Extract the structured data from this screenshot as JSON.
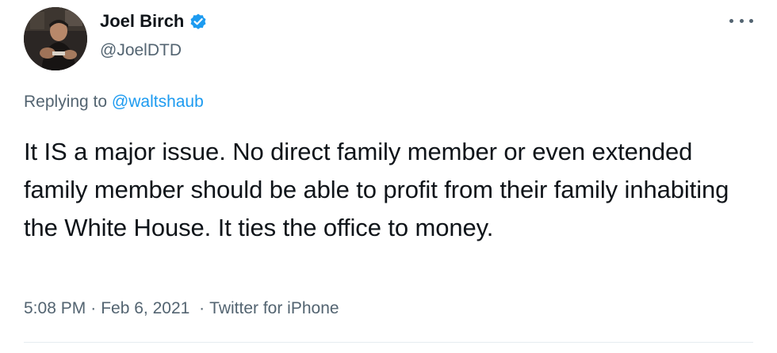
{
  "author": {
    "display_name": "Joel Birch",
    "handle": "@JoelDTD",
    "verified": true,
    "avatar_icon": "profile-photo"
  },
  "reply": {
    "prefix": "Replying to",
    "mention": "@waltshaub"
  },
  "tweet": {
    "text": "It IS a major issue. No direct family member or even extended family member should be able to profit from their family inhabiting the White House. It ties the office to money."
  },
  "meta": {
    "time": "5:08 PM",
    "date": "Feb 6, 2021",
    "source": "Twitter for iPhone",
    "separator": "·"
  },
  "icons": {
    "verified": "verified-badge-icon",
    "more": "more-options-icon"
  },
  "colors": {
    "accent": "#1d9bf0",
    "text_primary": "#0f1419",
    "text_secondary": "#536471"
  }
}
